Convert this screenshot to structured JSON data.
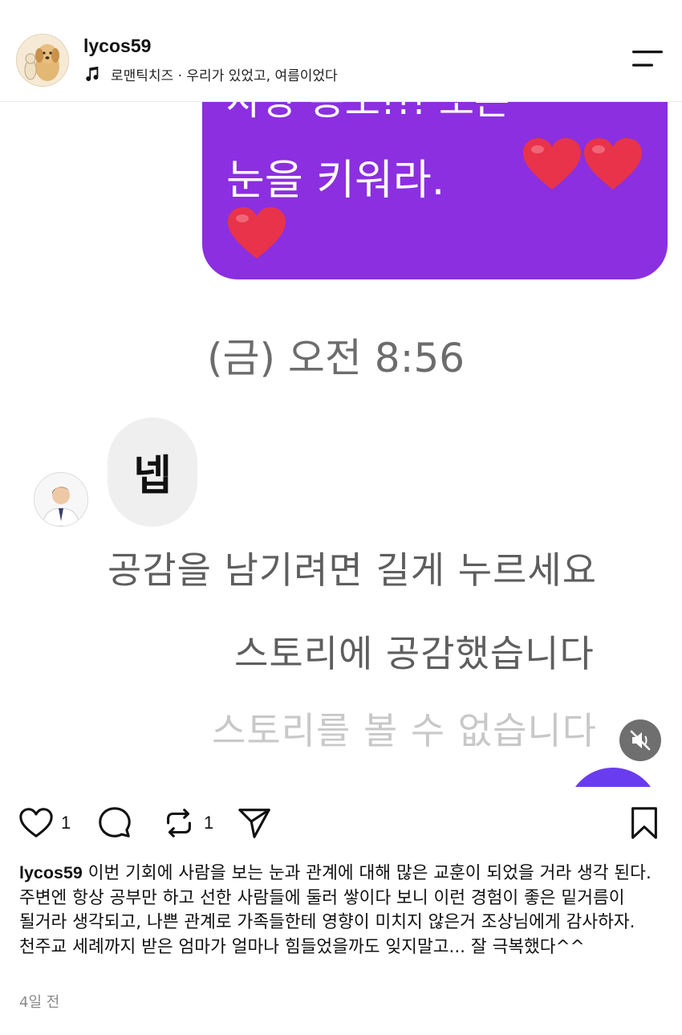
{
  "header": {
    "username": "lycos59",
    "music": "로맨틱치즈 · 우리가 있었고, 여름이었다"
  },
  "story": {
    "purple_message_line1": "사랑 용도!!! 또는",
    "purple_message_line2": "눈을 키워라.",
    "timestamp": "(금) 오전 8:56",
    "reply": "넵",
    "hint_long_press": "공감을 남기려면 길게 누르세요",
    "hint_liked": "스토리에 공감했습니다",
    "hint_unavailable": "스토리를 볼 수 없습니다"
  },
  "actions": {
    "like_count": "1",
    "repost_count": "1"
  },
  "caption": {
    "username": "lycos59",
    "text": "이번 기회에 사람을 보는 눈과 관계에 대해 많은 교훈이 되었을 거라 생각 된다. 주변엔 항상 공부만 하고 선한 사람들에 둘러 쌓이다 보니 이런 경험이 좋은 밑거름이 될거라 생각되고, 나쁜 관계로 가족들한테 영향이 미치지 않은거 조상님에게 감사하자. 천주교 세례까지 받은 엄마가 얼마나 힘들었을까도 잊지말고... 잘 극복했다^^",
    "time_ago": "4일 전"
  },
  "colors": {
    "purple_bubble": "#8b2fe0",
    "reply_bubble": "#efefef",
    "heart": "#e8334a"
  },
  "icons": [
    "music-note-icon",
    "menu-icon",
    "heart-icon",
    "comment-icon",
    "repost-icon",
    "share-icon",
    "bookmark-icon",
    "mute-icon"
  ]
}
